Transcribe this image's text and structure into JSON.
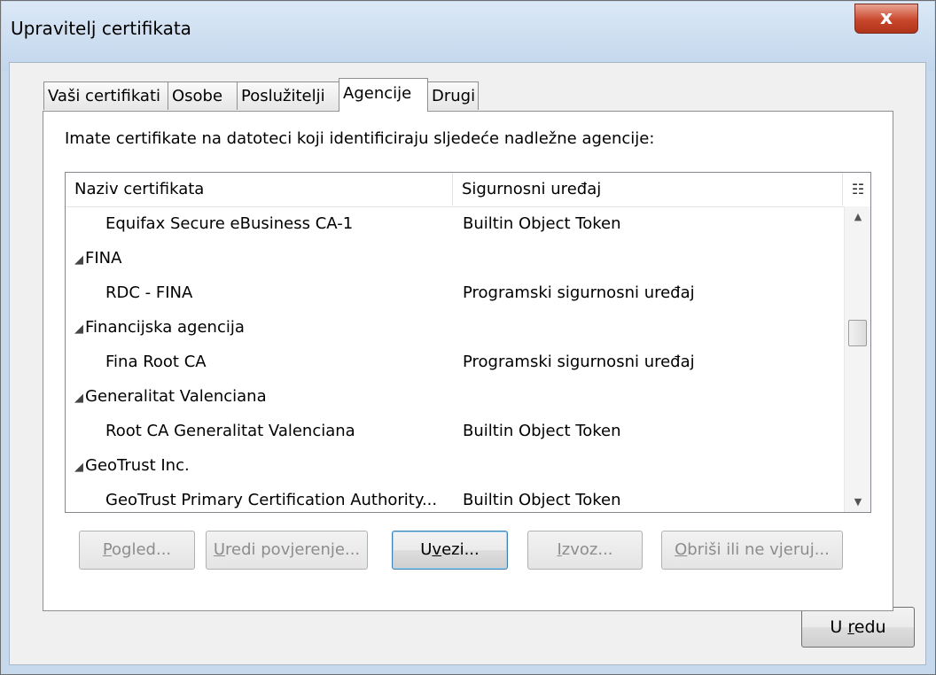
{
  "window": {
    "title": "Upravitelj certifikata",
    "close_glyph": "x"
  },
  "tabs": [
    {
      "label": "Vaši certifikati",
      "active": false
    },
    {
      "label": "Osobe",
      "active": false
    },
    {
      "label": "Poslužitelji",
      "active": false
    },
    {
      "label": "Agencije",
      "active": true
    },
    {
      "label": "Drugi",
      "active": false
    }
  ],
  "intro": "Imate certifikate na datoteci koji identificiraju sljedeće nadležne agencije:",
  "tree": {
    "columns": [
      "Naziv certifikata",
      "Sigurnosni uređaj"
    ],
    "column_picker_icon": "column-picker-icon",
    "rows": [
      {
        "name": "Equifax Secure eBusiness CA-1",
        "device": "Builtin Object Token",
        "group": false
      },
      {
        "name": "FINA",
        "device": "",
        "group": true
      },
      {
        "name": "RDC - FINA",
        "device": "Programski sigurnosni uređaj",
        "group": false
      },
      {
        "name": "Financijska agencija",
        "device": "",
        "group": true
      },
      {
        "name": "Fina Root CA",
        "device": "Programski sigurnosni uređaj",
        "group": false
      },
      {
        "name": "Generalitat Valenciana",
        "device": "",
        "group": true
      },
      {
        "name": "Root CA Generalitat Valenciana",
        "device": "Builtin Object Token",
        "group": false
      },
      {
        "name": "GeoTrust Inc.",
        "device": "",
        "group": true
      },
      {
        "name": "GeoTrust Primary Certification Authority...",
        "device": "Builtin Object Token",
        "group": false
      }
    ],
    "expander_glyph": "◢"
  },
  "buttons": {
    "view": {
      "before": "",
      "mnemonic": "P",
      "after": "ogled..."
    },
    "edit_trust": {
      "before": "",
      "mnemonic": "U",
      "after": "redi povjerenje..."
    },
    "import": {
      "before": "U",
      "mnemonic": "v",
      "after": "ezi..."
    },
    "export": {
      "before": "",
      "mnemonic": "I",
      "after": "zvoz..."
    },
    "delete": {
      "before": "",
      "mnemonic": "O",
      "after": "briši ili ne vjeruj..."
    }
  },
  "ok_button": {
    "before": "U ",
    "mnemonic": "r",
    "after": "edu"
  }
}
